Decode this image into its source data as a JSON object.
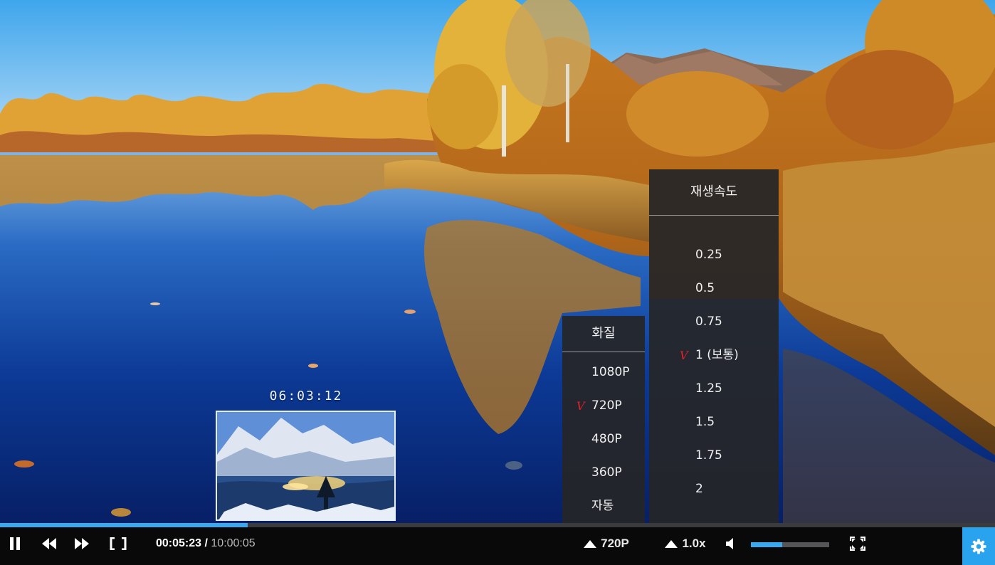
{
  "preview": {
    "time": "06:03:12"
  },
  "quality_menu": {
    "title": "화질",
    "items": [
      {
        "label": "1080P",
        "selected": false
      },
      {
        "label": "720P",
        "selected": true
      },
      {
        "label": "480P",
        "selected": false
      },
      {
        "label": "360P",
        "selected": false
      },
      {
        "label": "자동",
        "selected": false
      }
    ],
    "check_mark": "V"
  },
  "speed_menu": {
    "title": "재생속도",
    "items": [
      {
        "label": "0.25",
        "selected": false
      },
      {
        "label": "0.5",
        "selected": false
      },
      {
        "label": "0.75",
        "selected": false
      },
      {
        "label": "1 (보통)",
        "selected": true
      },
      {
        "label": "1.25",
        "selected": false
      },
      {
        "label": "1.5",
        "selected": false
      },
      {
        "label": "1.75",
        "selected": false
      },
      {
        "label": "2",
        "selected": false
      }
    ],
    "check_mark": "V"
  },
  "progress": {
    "played_fraction": 0.249
  },
  "controls": {
    "current_time": "00:05:23",
    "separator": " / ",
    "total_time": "10:00:05",
    "quality_label": "720P",
    "speed_label": "1.0x",
    "volume_fraction": 0.4,
    "icons": {
      "pause": "pause-icon",
      "rewind": "rewind-icon",
      "forward": "fast-forward-icon",
      "theater": "theater-mode-icon",
      "quality": "triangle-up-icon",
      "speed": "triangle-up-icon",
      "volume": "speaker-icon",
      "fullscreen": "fullscreen-icon",
      "settings": "gear-icon"
    }
  },
  "colors": {
    "accent": "#2aa3ee",
    "check": "#e0232b",
    "menu_bg": "#262628"
  }
}
